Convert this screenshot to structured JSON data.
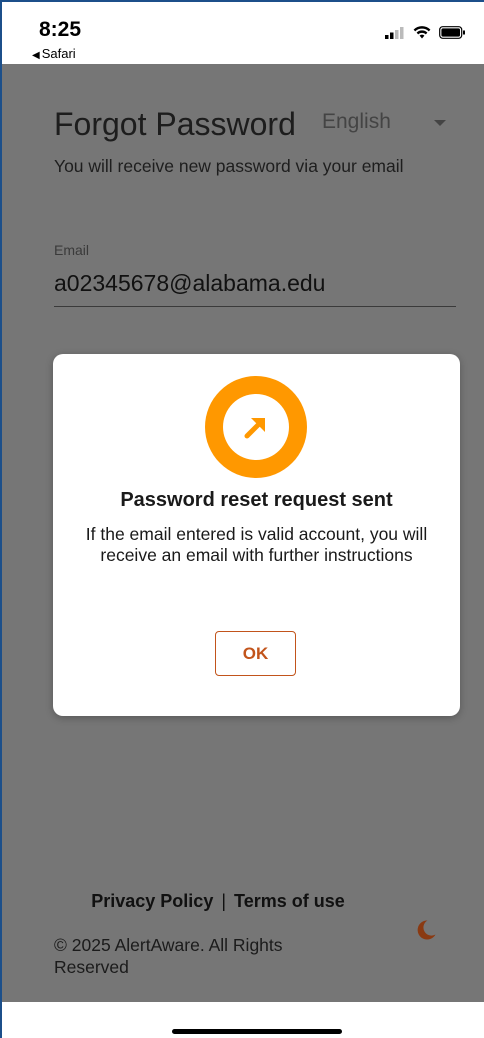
{
  "status_bar": {
    "time": "8:25",
    "back_app": "Safari"
  },
  "page": {
    "title": "Forgot Password",
    "language": "English",
    "subtitle": "You will receive new password via your email",
    "email_label": "Email",
    "email_value": "a02345678@alabama.edu"
  },
  "modal": {
    "icon": "arrow-up-right-icon",
    "title": "Password reset request sent",
    "message": "If the email entered is valid account, you will receive an email with further instructions",
    "ok_label": "OK"
  },
  "footer": {
    "privacy_label": "Privacy Policy",
    "separator": "|",
    "terms_label": "Terms of use",
    "copyright": "© 2025 AlertAware. All Rights Reserved"
  },
  "colors": {
    "overlay_background": "#767676",
    "accent_orange": "#ff9800",
    "button_text": "#c2541b",
    "moon_icon": "#8a3a12"
  }
}
